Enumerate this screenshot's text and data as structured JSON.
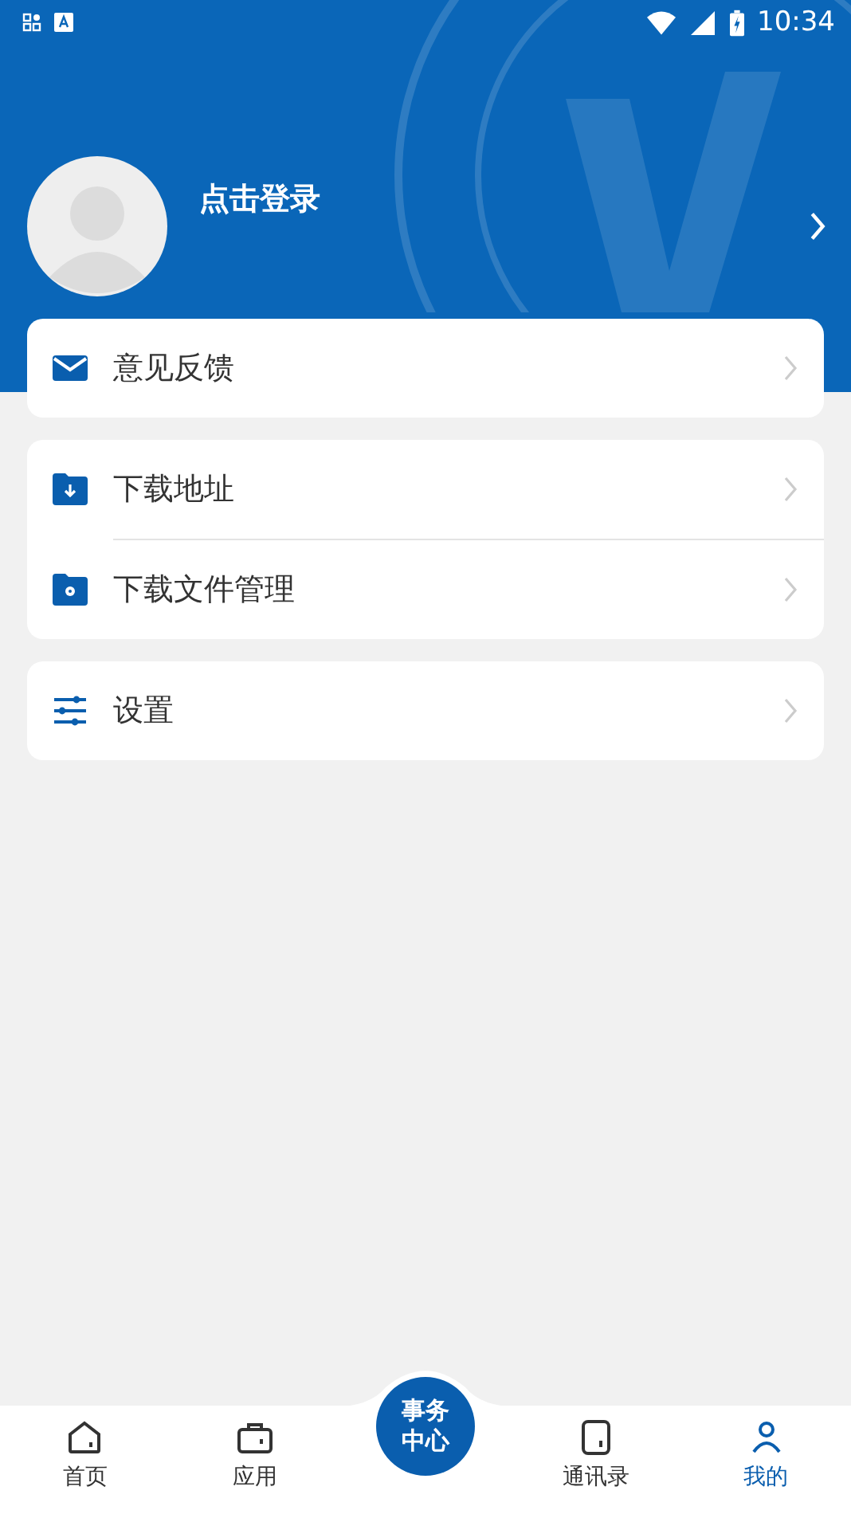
{
  "status_bar": {
    "time": "10:34"
  },
  "profile": {
    "login_label": "点击登录"
  },
  "menu_groups": [
    {
      "items": [
        {
          "label": "意见反馈"
        }
      ]
    },
    {
      "items": [
        {
          "label": "下载地址"
        },
        {
          "label": "下载文件管理"
        }
      ]
    },
    {
      "items": [
        {
          "label": "设置"
        }
      ]
    }
  ],
  "tab_bar": [
    {
      "label": "首页",
      "kind": "normal",
      "selected": false
    },
    {
      "label": "应用",
      "kind": "normal",
      "selected": false
    },
    {
      "label": "事务中心",
      "kind": "center",
      "selected": false
    },
    {
      "label": "通讯录",
      "kind": "normal",
      "selected": false
    },
    {
      "label": "我的",
      "kind": "normal",
      "selected": true
    }
  ]
}
